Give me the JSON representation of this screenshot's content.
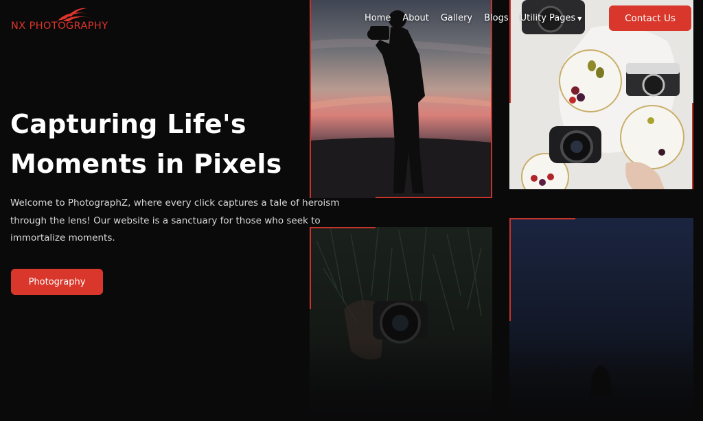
{
  "brand": {
    "name": "NX PHOTOGRAPHY",
    "accent": "#d9372b"
  },
  "nav": {
    "items": [
      "Home",
      "About",
      "Gallery",
      "Blogs",
      "Utility Pages"
    ],
    "caret_icon": "chevron-down-icon",
    "contact_label": "Contact Us"
  },
  "hero": {
    "title_line1": "Capturing Life's",
    "title_line2": "Moments in Pixels",
    "body": "Welcome to PhotographZ, where every click captures a tale of heroism through the lens! Our website is a sanctuary for those who seek to immortalize moments.",
    "cta_label": "Photography"
  },
  "gallery": {
    "images": [
      "photographer-silhouette-sunset",
      "cameras-flatlay-food",
      "camera-lens-grass",
      "night-sky-figure"
    ]
  }
}
